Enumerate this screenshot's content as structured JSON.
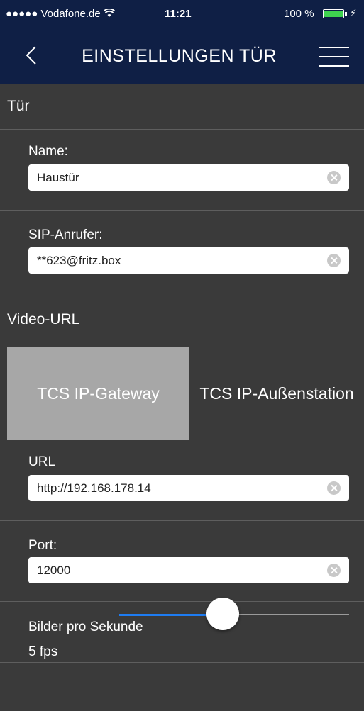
{
  "status_bar": {
    "carrier": "●●●●● Vodafone.de",
    "time": "11:21",
    "battery": "100 %"
  },
  "nav": {
    "title": "EINSTELLUNGEN TÜR"
  },
  "door_section": {
    "header": "Tür"
  },
  "fields": {
    "name": {
      "label": "Name:",
      "value": "Haustür"
    },
    "sip": {
      "label": "SIP-Anrufer:",
      "value": "**623@fritz.box"
    }
  },
  "video_section": {
    "header": "Video-URL",
    "segments": [
      "TCS IP-Gateway",
      "TCS IP-Außenstation"
    ],
    "selected_segment": "TCS IP-Gateway"
  },
  "url_fields": {
    "url": {
      "label": "URL",
      "value": "http://192.168.178.14"
    },
    "port": {
      "label": "Port:",
      "value": "12000"
    }
  },
  "fps": {
    "label": "Bilder pro Sekunde",
    "value": "5 fps",
    "slider_fraction": 0.45
  },
  "colors": {
    "nav_bg": "#0f1f45",
    "background": "#3a3a3a",
    "segment_active": "#a7a7a7",
    "slider_accent": "#1e7cf2",
    "battery": "#3fd34f"
  }
}
